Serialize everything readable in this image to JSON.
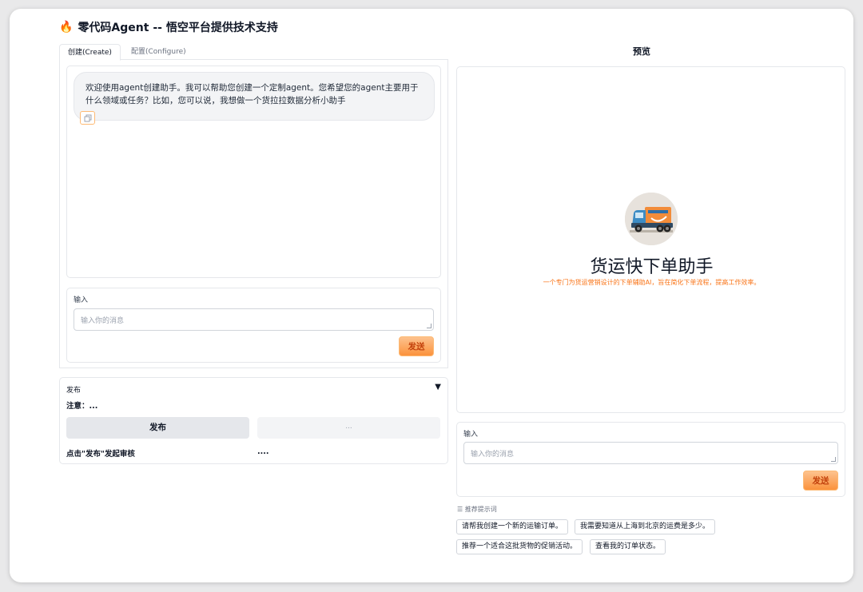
{
  "app": {
    "title": "零代码Agent -- 悟空平台提供技术支持",
    "title_icon": "fire-icon"
  },
  "tabs": [
    {
      "label": "创建(Create)",
      "active": true
    },
    {
      "label": "配置(Configure)",
      "active": false
    }
  ],
  "create": {
    "chat": {
      "messages": [
        {
          "role": "assistant",
          "text": "欢迎使用agent创建助手。我可以帮助您创建一个定制agent。您希望您的agent主要用于什么领域或任务？比如，您可以说，我想做一个货拉拉数据分析小助手"
        }
      ]
    },
    "input": {
      "label": "输入",
      "placeholder": "输入你的消息",
      "send_label": "发送"
    }
  },
  "publish": {
    "title": "发布",
    "note": "注意：...",
    "publish_button": "发布",
    "secondary_button": "...",
    "hint": "点击\"发布\"发起审核",
    "hint_value": "...."
  },
  "preview": {
    "title": "预览",
    "bot_name": "货运快下单助手",
    "bot_description": "一个专门为货运营销设计的下单辅助AI，旨在简化下单流程，提高工作效率。",
    "input": {
      "label": "输入",
      "placeholder": "输入你的消息",
      "send_label": "发送"
    },
    "prompts_title": "推荐提示词",
    "prompts": [
      "请帮我创建一个新的运输订单。",
      "我需要知道从上海到北京的运费是多少。",
      "推荐一个适合这批货物的促销活动。",
      "查看我的订单状态。"
    ]
  },
  "colors": {
    "accent": "#f97316",
    "send_bg": "#fdba74",
    "border": "#e5e7eb"
  }
}
